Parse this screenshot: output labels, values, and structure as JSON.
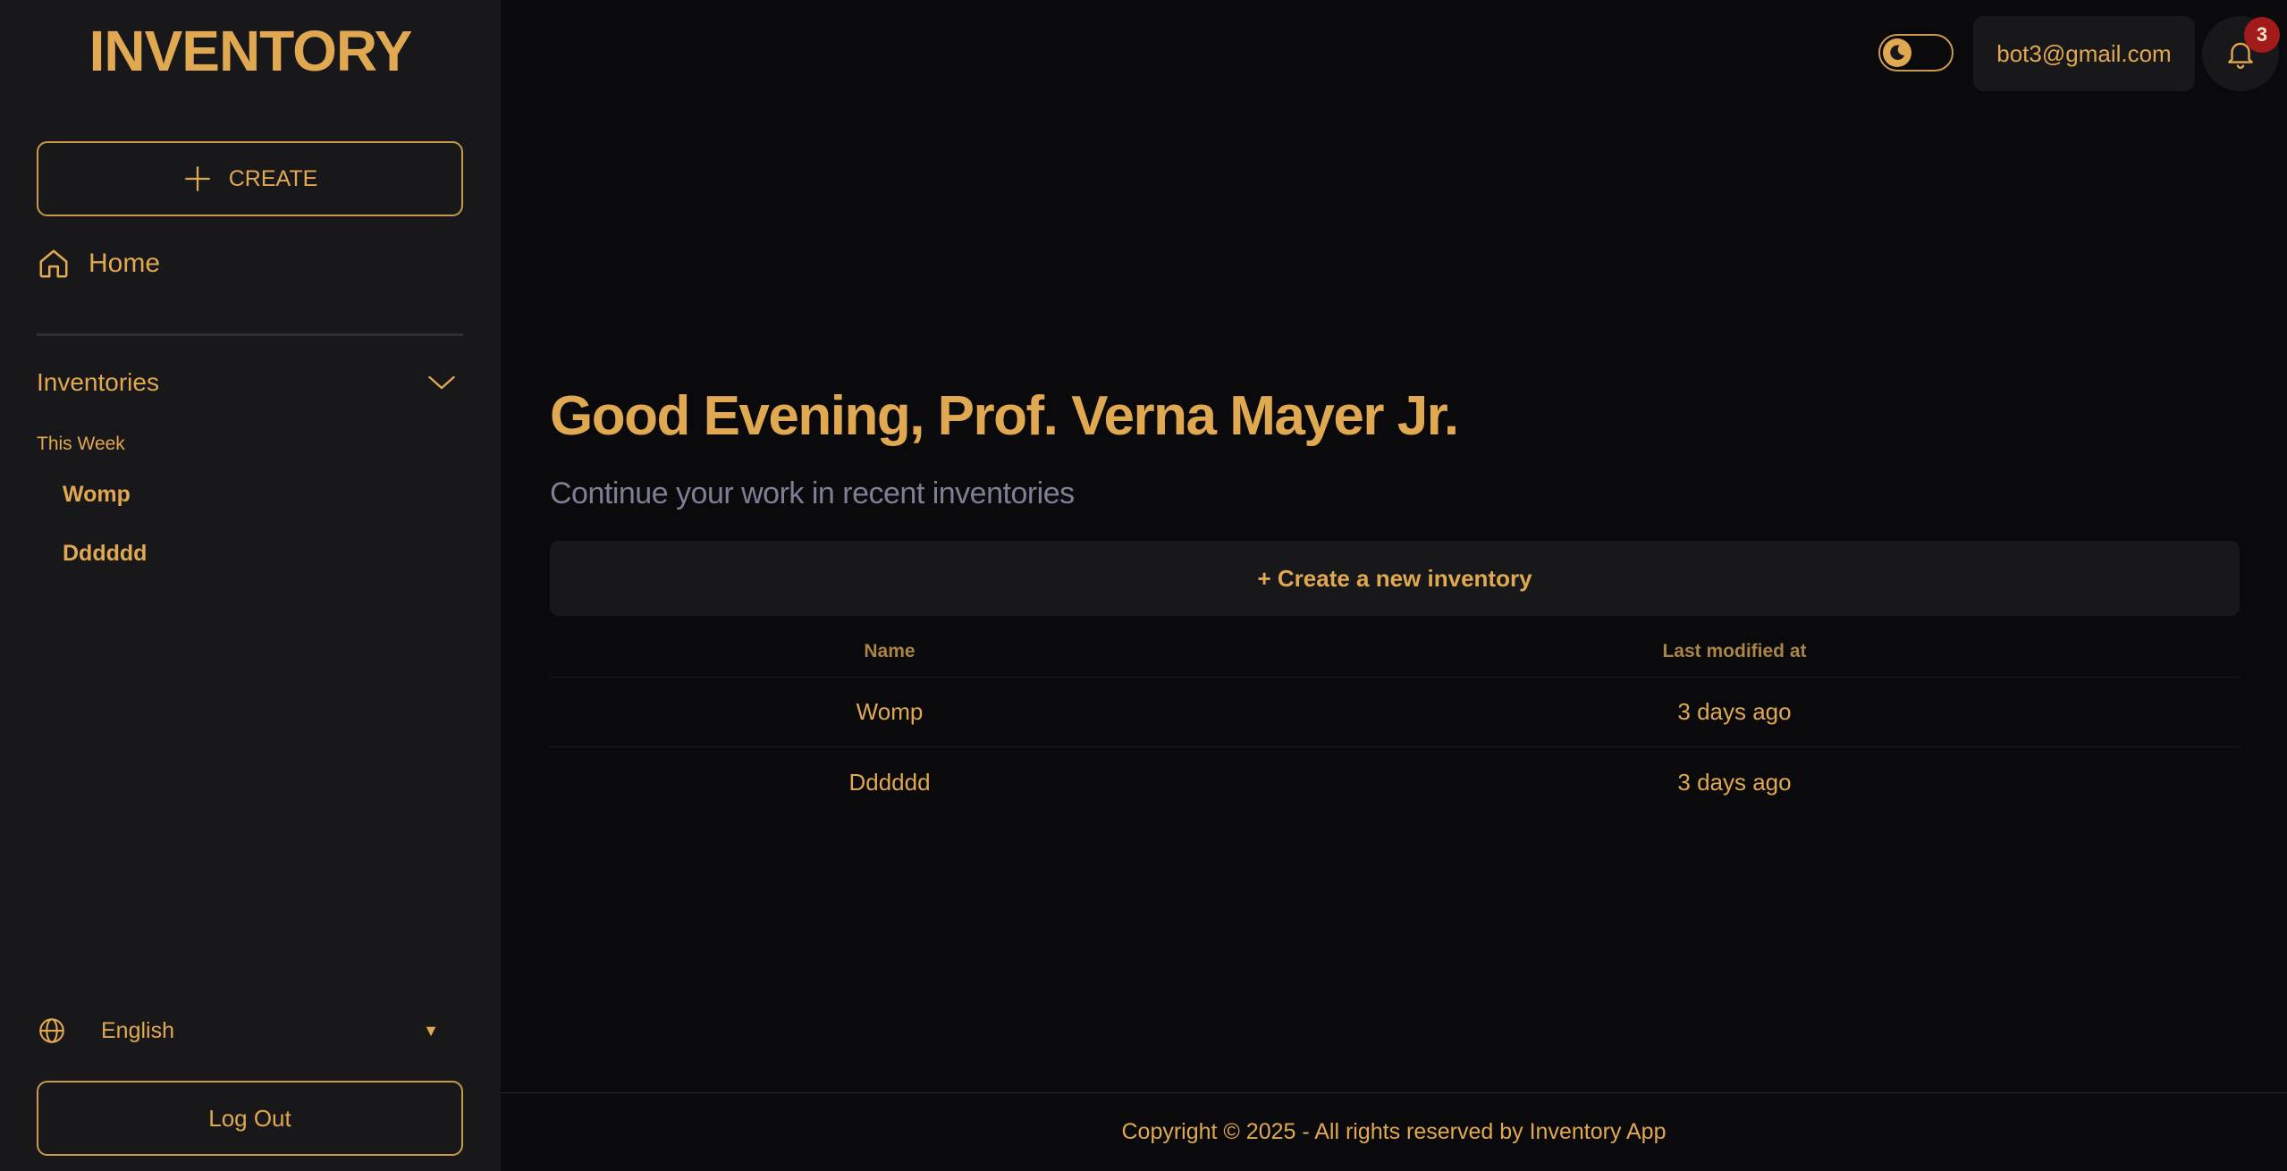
{
  "sidebar": {
    "brand": "INVENTORY",
    "create_label": "CREATE",
    "home_label": "Home",
    "section_label": "Inventories",
    "group_label": "This Week",
    "items": [
      {
        "label": "Womp"
      },
      {
        "label": "Dddddd"
      }
    ],
    "language": "English",
    "logout_label": "Log Out"
  },
  "header": {
    "user_email": "bot3@gmail.com",
    "notification_count": "3",
    "theme_toggle_icon": "moon-icon",
    "bell_icon": "bell-icon"
  },
  "main": {
    "greeting": "Good Evening, Prof. Verna Mayer Jr.",
    "subtitle": "Continue your work in recent inventories",
    "new_inventory_label": "+ Create a new inventory",
    "table": {
      "columns": [
        "Name",
        "Last modified at"
      ],
      "rows": [
        {
          "name": "Womp",
          "modified": "3 days ago"
        },
        {
          "name": "Dddddd",
          "modified": "3 days ago"
        }
      ]
    }
  },
  "footer": {
    "text": "Copyright © 2025 - All rights reserved by Inventory App"
  },
  "colors": {
    "accent": "#e0a851",
    "sidebar_bg": "#18181b",
    "page_bg": "#0a0a0c",
    "muted_text": "#7e7f95",
    "badge": "#a31a1a"
  }
}
